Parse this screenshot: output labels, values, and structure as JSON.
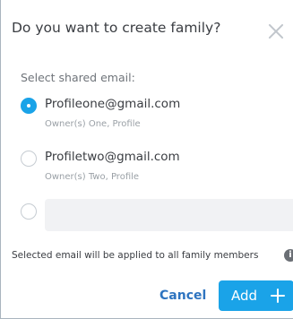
{
  "dialog": {
    "title": "Do you want to create family?",
    "section_label": "Select shared email:",
    "options": [
      {
        "email": "Profileone@gmail.com",
        "owner": "Owner(s) One, Profile",
        "selected": true
      },
      {
        "email": "Profiletwo@gmail.com",
        "owner": "Owner(s) Two, Profile",
        "selected": false
      }
    ],
    "custom_email": {
      "value": "",
      "placeholder": "",
      "selected": false
    },
    "notice": "Selected email will be applied to all family members",
    "cancel_label": "Cancel",
    "add_label": "Add",
    "close_icon": "close-icon",
    "info_icon": "info-icon",
    "plus_icon": "plus-icon"
  },
  "colors": {
    "accent": "#1aa3e8",
    "link": "#2e74c0",
    "text": "#3a3d42",
    "muted": "#9aa0a6"
  }
}
